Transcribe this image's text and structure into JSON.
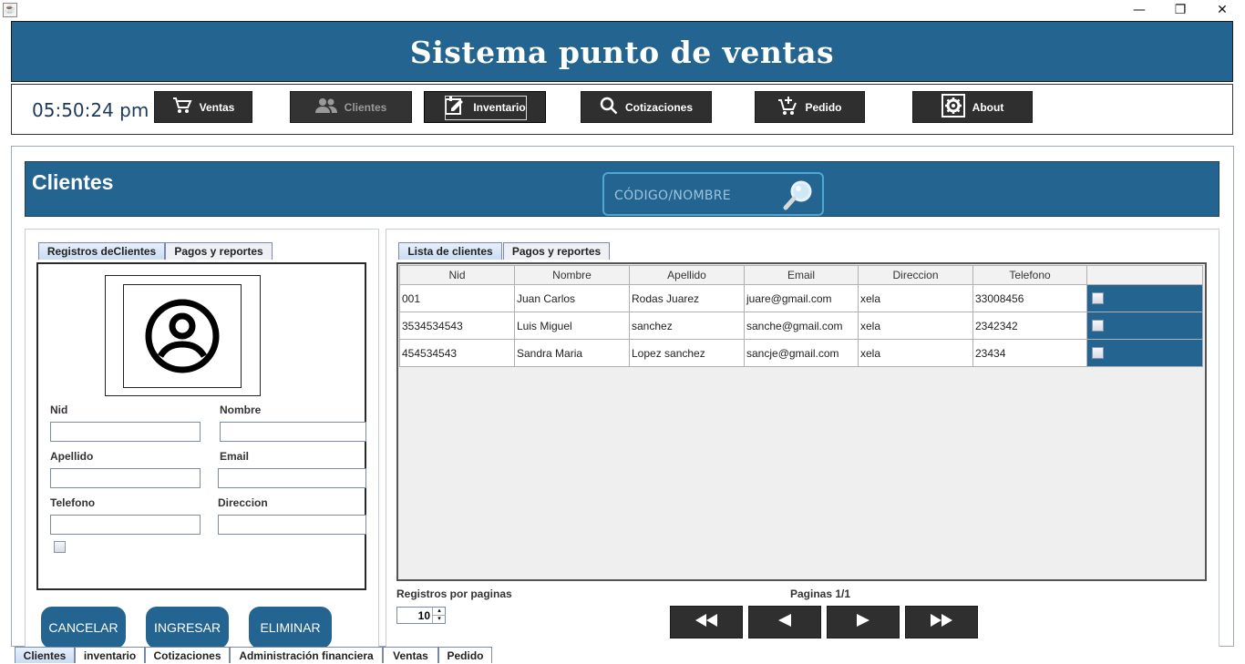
{
  "window": {
    "minimize": "—",
    "restore": "❐",
    "close": "✕",
    "app_icon": "java-app-icon"
  },
  "header": {
    "title": "Sistema punto de ventas"
  },
  "toolbar": {
    "clock": "05:50:24 pm",
    "buttons": [
      {
        "label": "Ventas",
        "icon": "cart-icon"
      },
      {
        "label": "Clientes",
        "icon": "users-icon"
      },
      {
        "label": "Inventario",
        "icon": "edit-note-icon"
      },
      {
        "label": "Cotizaciones",
        "icon": "search-icon"
      },
      {
        "label": "Pedido",
        "icon": "cart-add-icon"
      },
      {
        "label": "About",
        "icon": "gear-icon"
      }
    ]
  },
  "section": {
    "title": "Clientes",
    "search_placeholder": "CÓDIGO/NOMBRE"
  },
  "left": {
    "tabs": [
      "Registros deClientes",
      "Pagos y reportes"
    ],
    "fields": {
      "nid": "Nid",
      "nombre": "Nombre",
      "apellido": "Apellido",
      "email": "Email",
      "telefono": "Telefono",
      "direccion": "Direccion"
    },
    "buttons": {
      "cancelar": "CANCELAR",
      "ingresar": "INGRESAR",
      "eliminar": "ELIMINAR"
    }
  },
  "right": {
    "tabs": [
      "Lista de clientes",
      "Pagos y reportes"
    ],
    "columns": [
      "Nid",
      "Nombre",
      "Apellido",
      "Email",
      "Direccion",
      "Telefono",
      ""
    ],
    "rows": [
      [
        "001",
        "Juan Carlos",
        "Rodas Juarez",
        "juare@gmail.com",
        "xela",
        "33008456"
      ],
      [
        "3534534543",
        "Luis Miguel",
        "sanchez",
        "sanche@gmail.com",
        "xela",
        "2342342"
      ],
      [
        "454534543",
        "Sandra Maria",
        "Lopez sanchez",
        "sancje@gmail.com",
        "xela",
        "23434"
      ]
    ],
    "registros_label": "Registros por paginas",
    "registros_value": "10",
    "paginas_label": "Paginas 1/1"
  },
  "bottom_tabs": [
    "Clientes",
    "inventario",
    "Cotizaciones",
    "Administración financiera",
    "Ventas",
    "Pedido"
  ],
  "colors": {
    "primary": "#236491",
    "dark_button": "#2f2f2f",
    "search_border": "#4fa7d4"
  }
}
